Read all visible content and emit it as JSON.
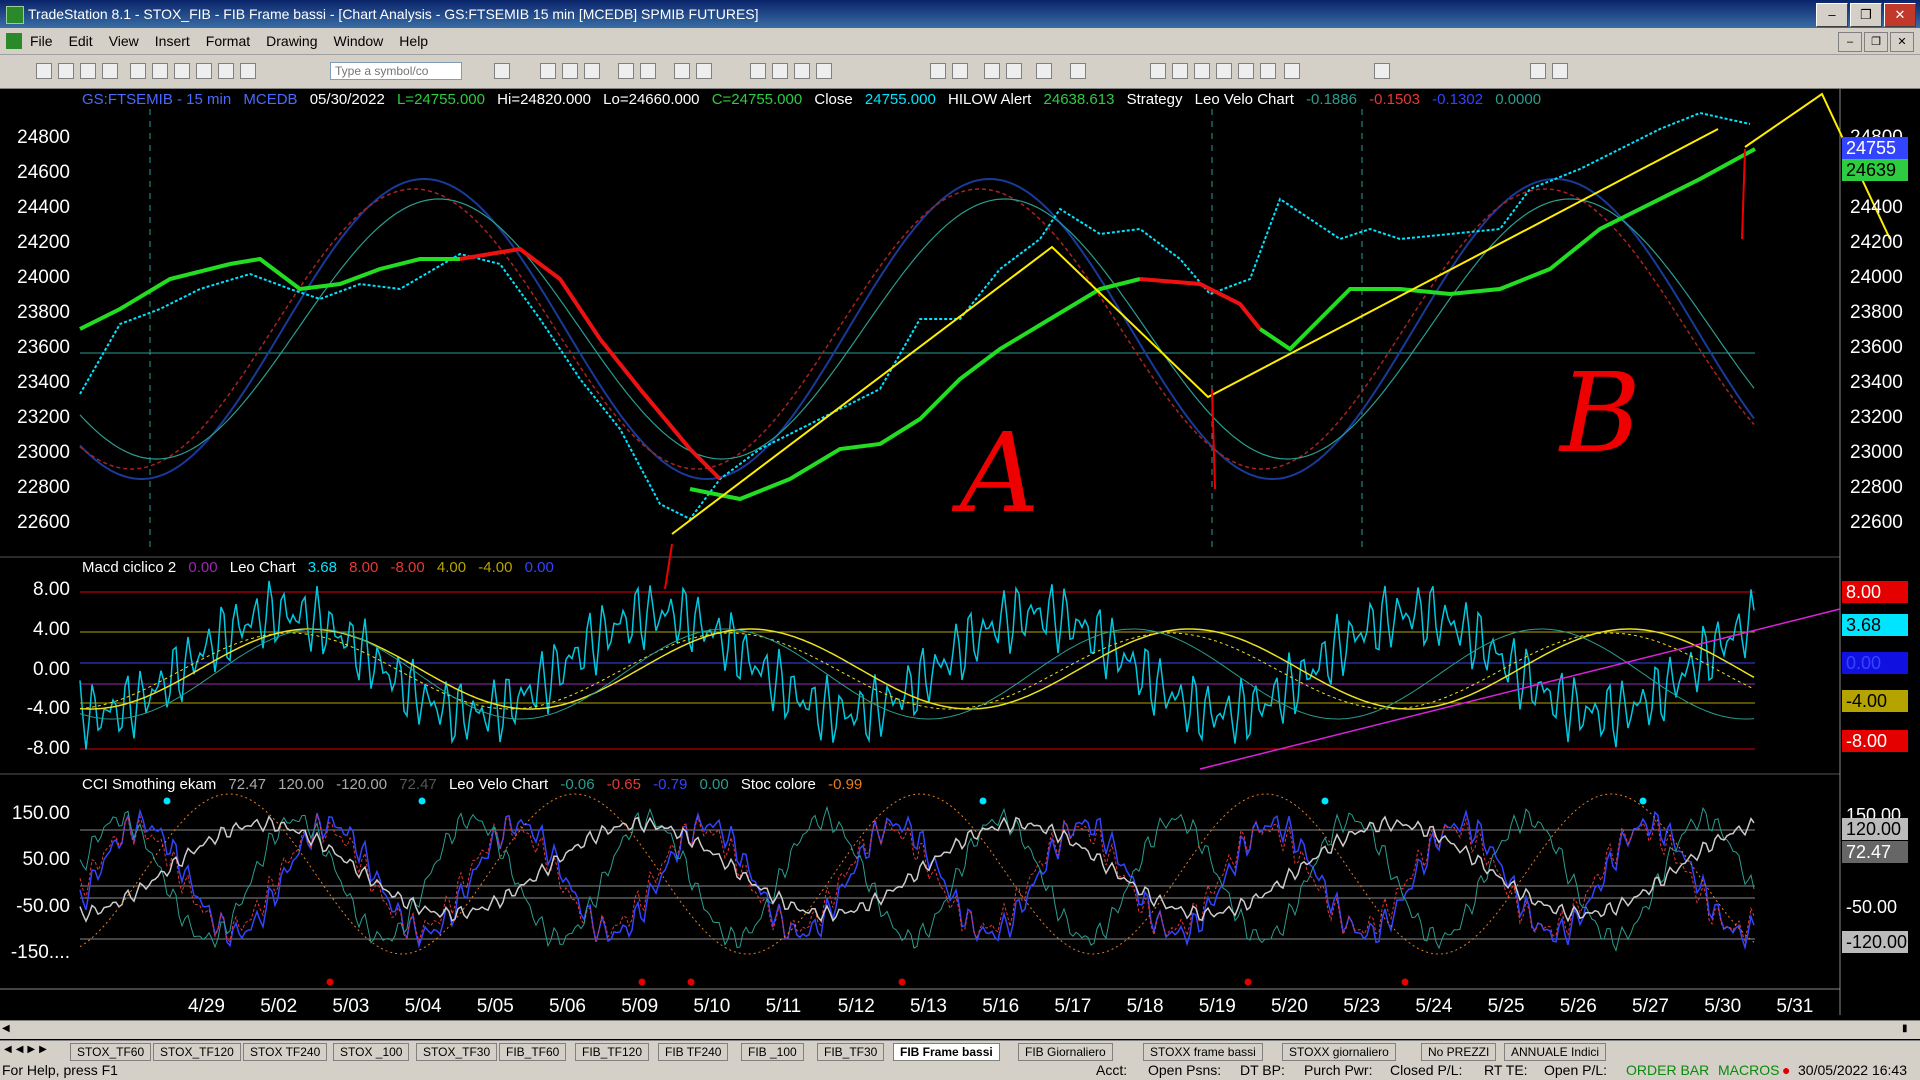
{
  "window": {
    "title": "TradeStation 8.1 - STOX_FIB - FIB Frame bassi - [Chart Analysis - GS:FTSEMIB 15 min  [MCEDB] SPMIB FUTURES]"
  },
  "menu": [
    "File",
    "Edit",
    "View",
    "Insert",
    "Format",
    "Drawing",
    "Window",
    "Help"
  ],
  "toolbar": {
    "symbol_placeholder": "Type a symbol/co"
  },
  "price_pane": {
    "symbol": "GS:FTSEMIB - 15 min",
    "feed": "MCEDB",
    "date": "05/30/2022",
    "last": "L=24755.000",
    "hi": "Hi=24820.000",
    "lo": "Lo=24660.000",
    "close_eq": "C=24755.000",
    "close_label": "Close",
    "close_value": "24755.000",
    "hilow_label": "HILOW Alert",
    "hilow_value": "24638.613",
    "strategy_label": "Strategy",
    "leo_velo_label": "Leo Velo Chart",
    "leo_v1": "-0.1886",
    "leo_v2": "-0.1503",
    "leo_v3": "-0.1302",
    "leo_v4": "0.0000",
    "yticks": [
      "24800",
      "24600",
      "24400",
      "24200",
      "24000",
      "23800",
      "23600",
      "23400",
      "23200",
      "23000",
      "22800",
      "22600"
    ],
    "last_tag": "24755",
    "hilow_tag": "24639",
    "annotations": {
      "a": "A",
      "b": "B"
    },
    "trade_marks": [
      "1",
      "-1",
      "1",
      "-1",
      "1",
      "-1",
      "1",
      "-1",
      "1",
      "-1",
      "1",
      "-1",
      "1",
      "1",
      "1",
      "-1",
      "1",
      "-1",
      "1"
    ]
  },
  "macd_pane": {
    "name": "Macd ciclico 2",
    "v0": "0.00",
    "leo_label": "Leo Chart",
    "v1": "3.68",
    "v2": "8.00",
    "v3": "-8.00",
    "v4": "4.00",
    "v5": "-4.00",
    "v6": "0.00",
    "yticks": [
      "8.00",
      "4.00",
      "0.00",
      "-4.00",
      "-8.00"
    ],
    "tags": {
      "t8": "8.00",
      "t368": "3.68",
      "t0": "0.00",
      "tm4": "-4.00",
      "tm8": "-8.00"
    }
  },
  "cci_pane": {
    "name": "CCI Smothing ekam",
    "v1": "72.47",
    "v2": "120.00",
    "v3": "-120.00",
    "v4": "72.47",
    "leo_velo_label": "Leo Velo Chart",
    "lv1": "-0.06",
    "lv2": "-0.65",
    "lv3": "-0.79",
    "lv4": "0.00",
    "stoc_label": "Stoc colore",
    "stoc_val": "-0.99",
    "yticks": [
      "150.00",
      "50.00",
      "-50.00",
      "-150...."
    ],
    "tags": {
      "t150": "150.00",
      "t120": "120.00",
      "t72": "72.47",
      "t50": "50.00",
      "tm50": "-50.00",
      "tm120": "-120.00",
      "tm150": "-150.00"
    }
  },
  "xaxis": [
    "4/29",
    "5/02",
    "5/03",
    "5/04",
    "5/05",
    "5/06",
    "5/09",
    "5/10",
    "5/11",
    "5/12",
    "5/13",
    "5/16",
    "5/17",
    "5/18",
    "5/19",
    "5/20",
    "5/23",
    "5/24",
    "5/25",
    "5/26",
    "5/27",
    "5/30",
    "5/31"
  ],
  "tabs": [
    "STOX_TF60",
    "STOX_TF120",
    "STOX TF240",
    "STOX _100",
    "STOX_TF30",
    "FIB_TF60",
    "FIB_TF120",
    "FIB TF240",
    "FIB _100",
    "FIB_TF30",
    "FIB Frame bassi",
    "FIB Giornaliero",
    "STOXX frame bassi",
    "STOXX giornaliero",
    "No PREZZI",
    "ANNUALE Indici"
  ],
  "active_tab": "FIB Frame bassi",
  "status": {
    "help": "For Help, press F1",
    "acct": "Acct:",
    "open_psns": "Open Psns:",
    "dt_bp": "DT BP:",
    "purch_pwr": "Purch Pwr:",
    "closed_pl": "Closed P/L:",
    "rt_te": "RT TE:",
    "open_pl": "Open P/L:",
    "order_bar": "ORDER BAR",
    "macros": "MACROS",
    "datetime": "30/05/2022 16:43"
  }
}
